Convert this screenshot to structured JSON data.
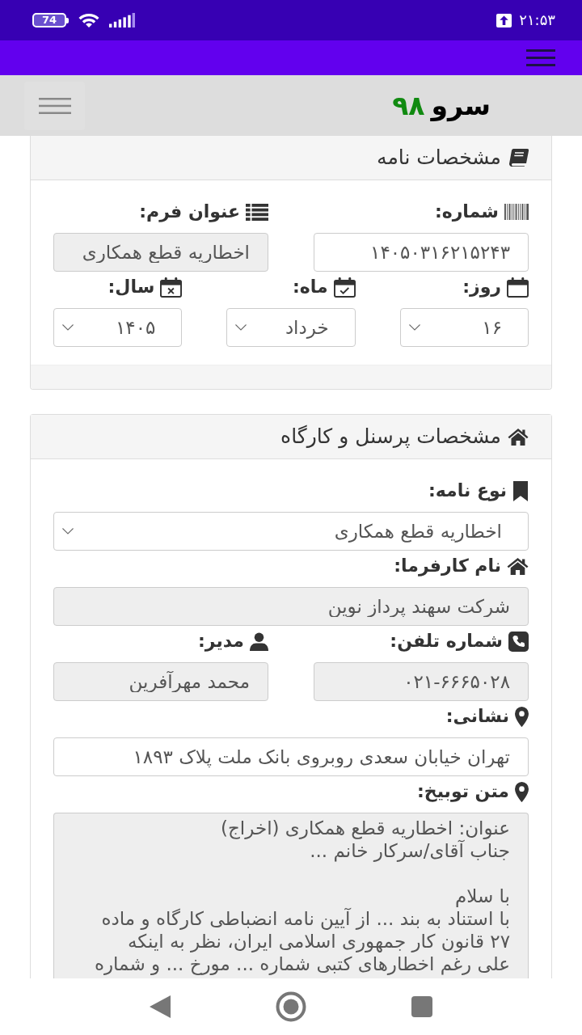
{
  "status_bar": {
    "battery": "74",
    "time": "۲۱:۵۳"
  },
  "header": {
    "logo_text": "سرو",
    "logo_number": "۹۸"
  },
  "cards": [
    {
      "title": "مشخصات نامه",
      "footer": true,
      "form_rows": [
        {
          "fields": [
            {
              "label": "شماره:",
              "kind": "input",
              "value": "۱۴۰۵۰۳۱۶۲۱۵۲۴۳",
              "readonly": false
            },
            {
              "label": "عنوان فرم:",
              "kind": "input",
              "value": "اخطاریه قطع همکاری",
              "readonly": true
            }
          ]
        },
        {
          "fields": [
            {
              "label": "روز:",
              "kind": "select",
              "value": "۱۶"
            },
            {
              "label": "ماه:",
              "kind": "select",
              "value": "خرداد"
            },
            {
              "label": "سال:",
              "kind": "select",
              "value": "۱۴۰۵"
            }
          ]
        }
      ]
    },
    {
      "title": "مشخصات پرسنل و کارگاه",
      "form_rows": [
        {
          "fields": [
            {
              "label": "نوع نامه:",
              "kind": "select",
              "value": "اخطاریه قطع همکاری"
            }
          ]
        },
        {
          "fields": [
            {
              "label": "نام کارفرما:",
              "kind": "input",
              "value": "شرکت سهند پرداز نوین",
              "readonly": true
            }
          ]
        },
        {
          "fields": [
            {
              "label": "شماره تلفن:",
              "kind": "input",
              "value": "۰۲۱-۶۶۶۵۰۲۸",
              "readonly": true
            },
            {
              "label": "مدیر:",
              "kind": "input",
              "value": "محمد مهرآفرین",
              "readonly": true
            }
          ]
        },
        {
          "fields": [
            {
              "label": "نشانی:",
              "kind": "input",
              "value": "تهران خیابان سعدی روبروی بانک ملت پلاک ۱۸۹۳",
              "readonly": false
            }
          ]
        },
        {
          "fields": [
            {
              "label": "متن توبیخ:",
              "kind": "textarea",
              "value": "عنوان: اخطاریه قطع همکاری (اخراج)\nجناب آقای/سرکار خانم ...\n\nبا سلام\nبا استناد به بند ... از آیین نامه انضباطی کارگاه و ماده\n۲۷ قانون کار جمهوری اسلامی ایران، نظر به اینکه\nعلی رغم اخطارهای کتبی شماره ... مورخ ... و شماره",
              "readonly": true
            }
          ]
        }
      ]
    }
  ]
}
